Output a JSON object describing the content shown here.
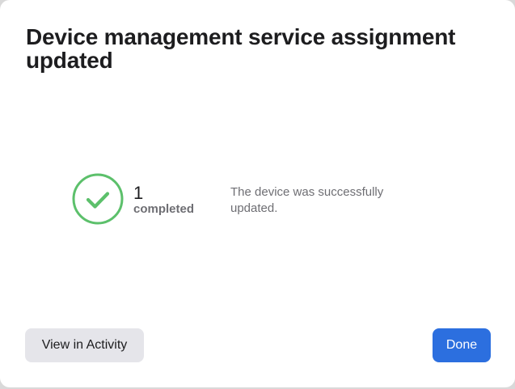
{
  "dialog": {
    "title": "Device management service assignment updated"
  },
  "result": {
    "icon": "checkmark-circle-icon",
    "count": "1",
    "count_label": "completed",
    "message": "The device was successfully updated.",
    "accent_color": "#5cc06b"
  },
  "actions": {
    "view_activity_label": "View in Activity",
    "done_label": "Done",
    "primary_color": "#2c6fdf"
  }
}
